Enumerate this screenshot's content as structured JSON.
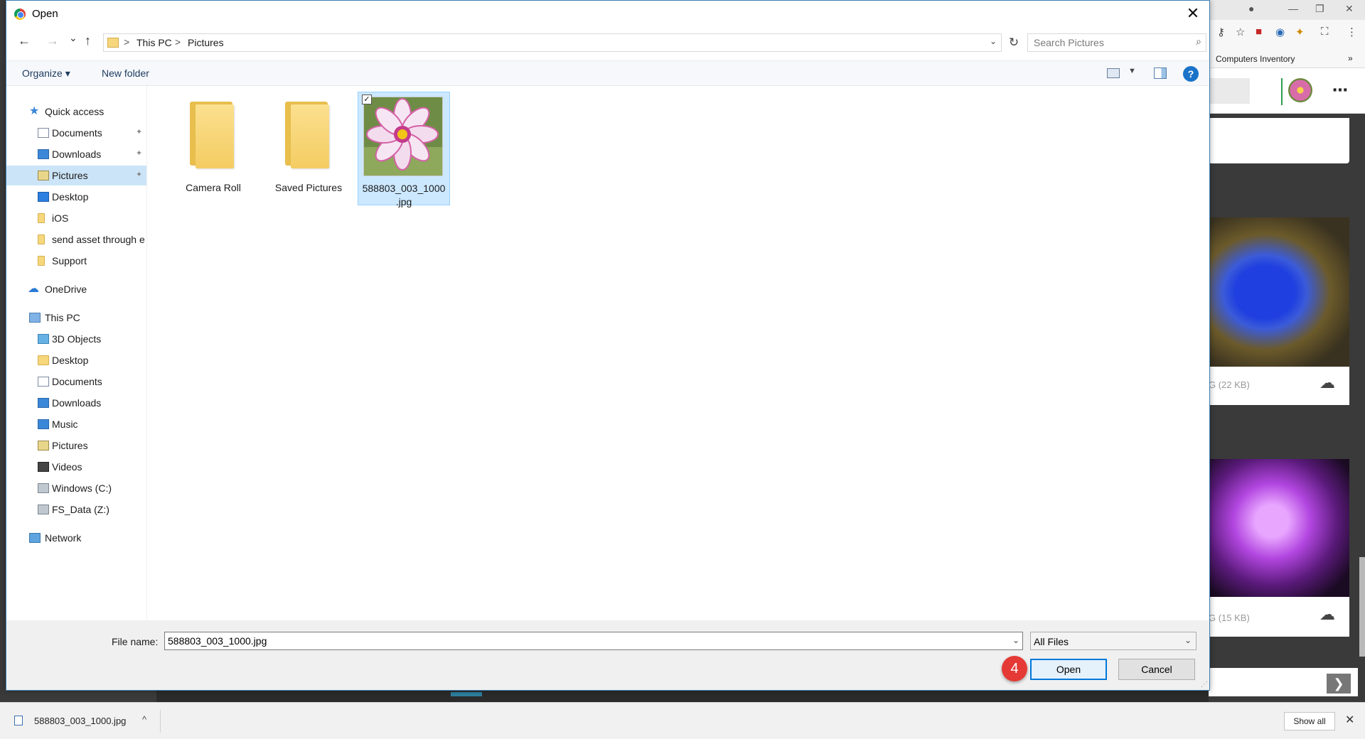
{
  "dialog": {
    "title": "Open",
    "close_glyph": "✕"
  },
  "nav": {
    "back_glyph": "←",
    "forward_glyph": "→",
    "recent_glyph": "⌄",
    "up_glyph": "↑",
    "breadcrumbs": [
      "This PC",
      "Pictures"
    ],
    "crumb_sep": ">",
    "refresh_glyph": "↻",
    "search_placeholder": "Search Pictures"
  },
  "commands": {
    "organize": "Organize ▾",
    "new_folder": "New folder",
    "help": "?"
  },
  "navpane": {
    "quick_access": "Quick access",
    "quick_items": [
      {
        "label": "Documents",
        "pinned": true
      },
      {
        "label": "Downloads",
        "pinned": true
      },
      {
        "label": "Pictures",
        "pinned": true,
        "selected": true
      },
      {
        "label": "Desktop",
        "pinned": false
      },
      {
        "label": "iOS",
        "pinned": false
      },
      {
        "label": "send asset through e",
        "pinned": false
      },
      {
        "label": "Support",
        "pinned": false
      }
    ],
    "onedrive": "OneDrive",
    "this_pc": "This PC",
    "pc_items": [
      "3D Objects",
      "Desktop",
      "Documents",
      "Downloads",
      "Music",
      "Pictures",
      "Videos",
      "Windows (C:)",
      "FS_Data (Z:)"
    ],
    "network": "Network",
    "pin_glyph": "📌"
  },
  "files": [
    {
      "name": "Camera Roll",
      "type": "folder"
    },
    {
      "name": "Saved Pictures",
      "type": "folder"
    },
    {
      "name": "588803_003_1000",
      "name2": ".jpg",
      "type": "image",
      "selected": true
    }
  ],
  "bottom": {
    "file_name_label": "File name:",
    "file_name_value": "588803_003_1000.jpg",
    "filter": "All Files",
    "open": "Open",
    "cancel": "Cancel",
    "step": "4"
  },
  "browser": {
    "bookmark": "Computers Inventory",
    "bookmark_more": "»",
    "size1": "G (22 KB)",
    "size2": "G (15 KB)",
    "more_glyph": "⋯"
  },
  "shelf": {
    "file": "588803_003_1000.jpg",
    "chevron": "^",
    "show_all": "Show all",
    "close": "✕"
  },
  "colors": {
    "accent": "#0078d7",
    "selection": "#cce8ff",
    "badge": "#e53935"
  }
}
